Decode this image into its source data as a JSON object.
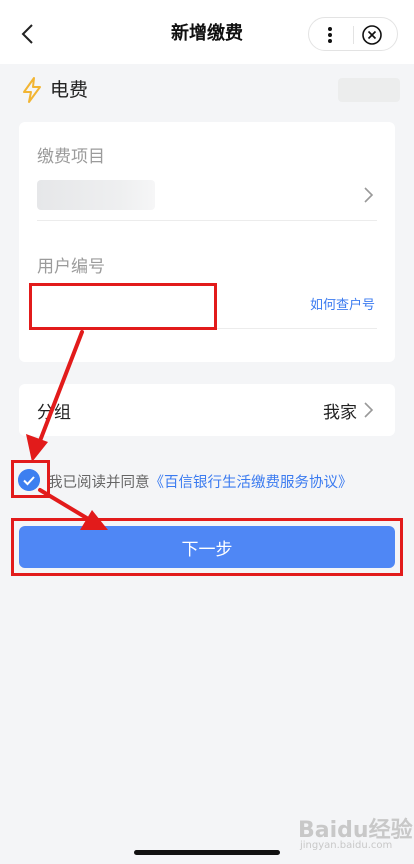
{
  "header": {
    "title": "新增缴费",
    "back_icon": "chevron-left-icon",
    "more_icon": "more-vertical-icon",
    "close_icon": "close-circle-icon"
  },
  "bill": {
    "icon": "lightning-icon",
    "icon_color": "#f2b533",
    "name": "电费"
  },
  "form": {
    "item_label": "缴费项目",
    "user_no_label": "用户编号",
    "user_no_value": "",
    "query_link": "如何查户号"
  },
  "group": {
    "label": "分组",
    "value": "我家"
  },
  "agreement": {
    "text": "我已阅读并同意",
    "link": "《百信银行生活缴费服务协议》",
    "checked": true
  },
  "next_button": "下一步",
  "colors": {
    "primary": "#4f87f5",
    "link": "#3b7bf0",
    "annotation": "#e21b1b"
  },
  "watermark": {
    "text": "Baidu经验",
    "sub": "jingyan.baidu.com"
  }
}
